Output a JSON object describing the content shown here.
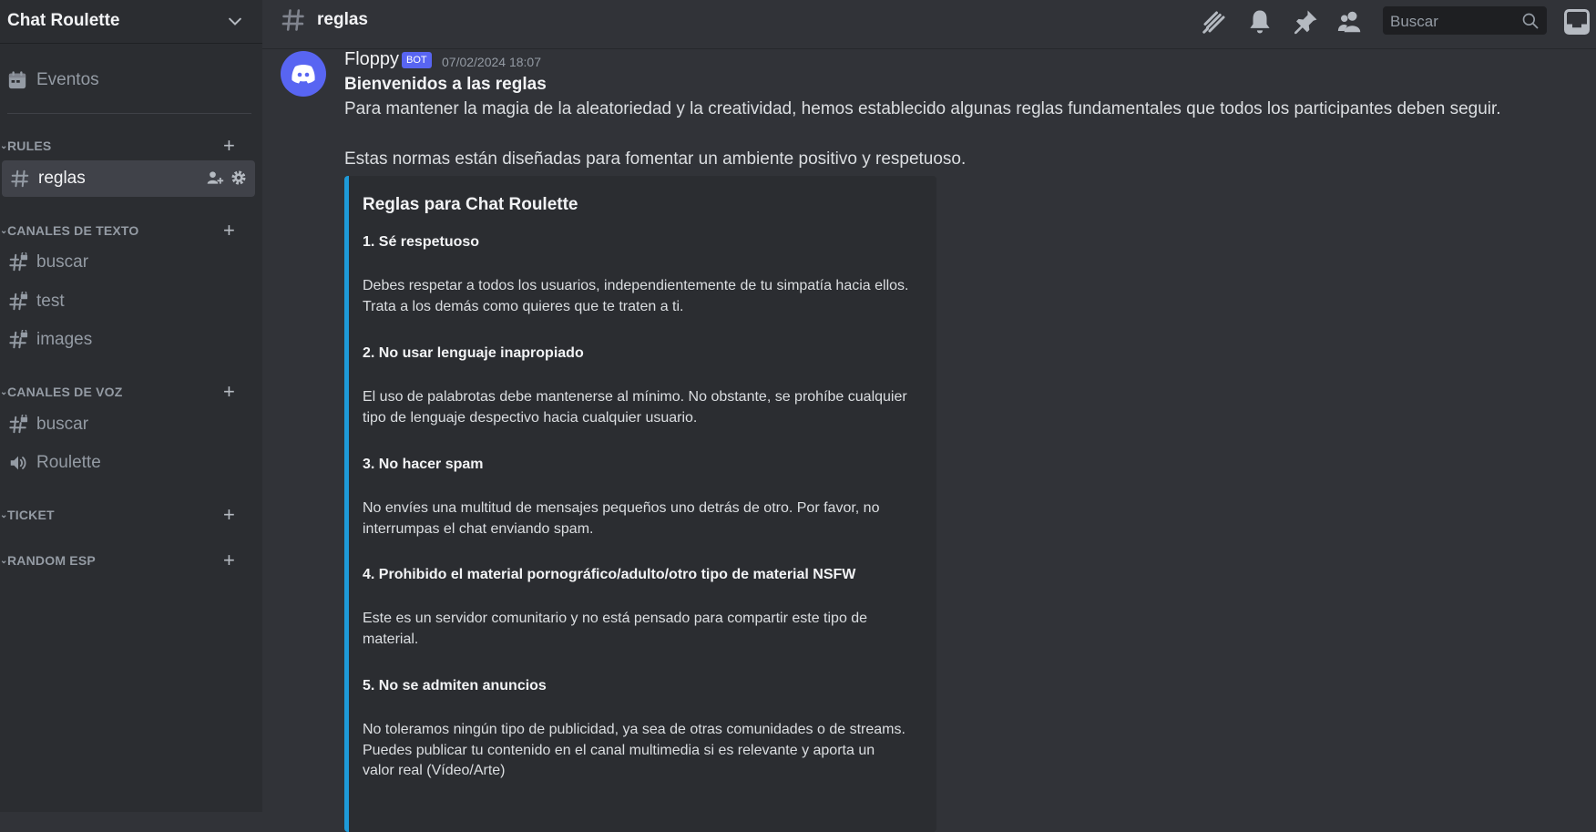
{
  "server": {
    "name": "Chat Roulette"
  },
  "sidebar": {
    "events_label": "Eventos",
    "categories": [
      {
        "label": "RULES"
      },
      {
        "label": "CANALES DE TEXTO"
      },
      {
        "label": "CANALES DE VOZ"
      },
      {
        "label": "TICKET"
      },
      {
        "label": "RANDOM ESP"
      }
    ],
    "channels": {
      "rules": [
        {
          "name": "reglas",
          "icon": "hash-icon",
          "active": true
        }
      ],
      "text": [
        {
          "name": "buscar",
          "icon": "locked-hash-icon"
        },
        {
          "name": "test",
          "icon": "locked-hash-icon"
        },
        {
          "name": "images",
          "icon": "locked-hash-icon"
        }
      ],
      "voice": [
        {
          "name": "buscar",
          "icon": "locked-hash-icon"
        },
        {
          "name": "Roulette",
          "icon": "speaker-icon"
        }
      ]
    }
  },
  "topbar": {
    "channel_name": "reglas",
    "search_placeholder": "Buscar",
    "icons": [
      "threads-icon",
      "bell-icon",
      "pin-icon",
      "members-icon",
      "inbox-icon"
    ]
  },
  "message": {
    "author": "Floppy",
    "bot_tag": "BOT",
    "timestamp": "07/02/2024 18:07",
    "title": "Bienvenidos a las reglas",
    "line1": "Para mantener la magia de la aleatoriedad y la creatividad, hemos establecido algunas reglas fundamentales que todos los participantes deben seguir.",
    "line2": "Estas normas están diseñadas para fomentar un ambiente positivo y respetuoso.",
    "embed": {
      "title": "Reglas para Chat Roulette",
      "rules": [
        {
          "heading": "1. Sé respetuoso",
          "body": "Debes respetar a todos los usuarios, independientemente de tu simpatía hacia ellos. Trata a los demás como quieres que te traten a ti."
        },
        {
          "heading": "2. No usar lenguaje inapropiado",
          "body": "El uso de palabrotas debe mantenerse al mínimo. No obstante, se prohíbe cualquier tipo de lenguaje despectivo hacia cualquier usuario."
        },
        {
          "heading": "3. No hacer spam",
          "body": "No envíes una multitud de mensajes pequeños uno detrás de otro. Por favor, no interrumpas el chat enviando spam."
        },
        {
          "heading": "4. Prohibido el material pornográfico/adulto/otro tipo de material NSFW",
          "body": "Este es un servidor comunitario y no está pensado para compartir este tipo de material."
        },
        {
          "heading": "5. No se admiten anuncios",
          "body": "No toleramos ningún tipo de publicidad, ya sea de otras comunidades o de streams. Puedes publicar tu contenido en el canal multimedia si es relevante y aporta un valor real (Vídeo/Arte)"
        }
      ]
    }
  },
  "colors": {
    "background": "#313338",
    "sidebar": "#2b2d31",
    "accent": "#5865f2",
    "embed_border": "#1e9ad8"
  }
}
